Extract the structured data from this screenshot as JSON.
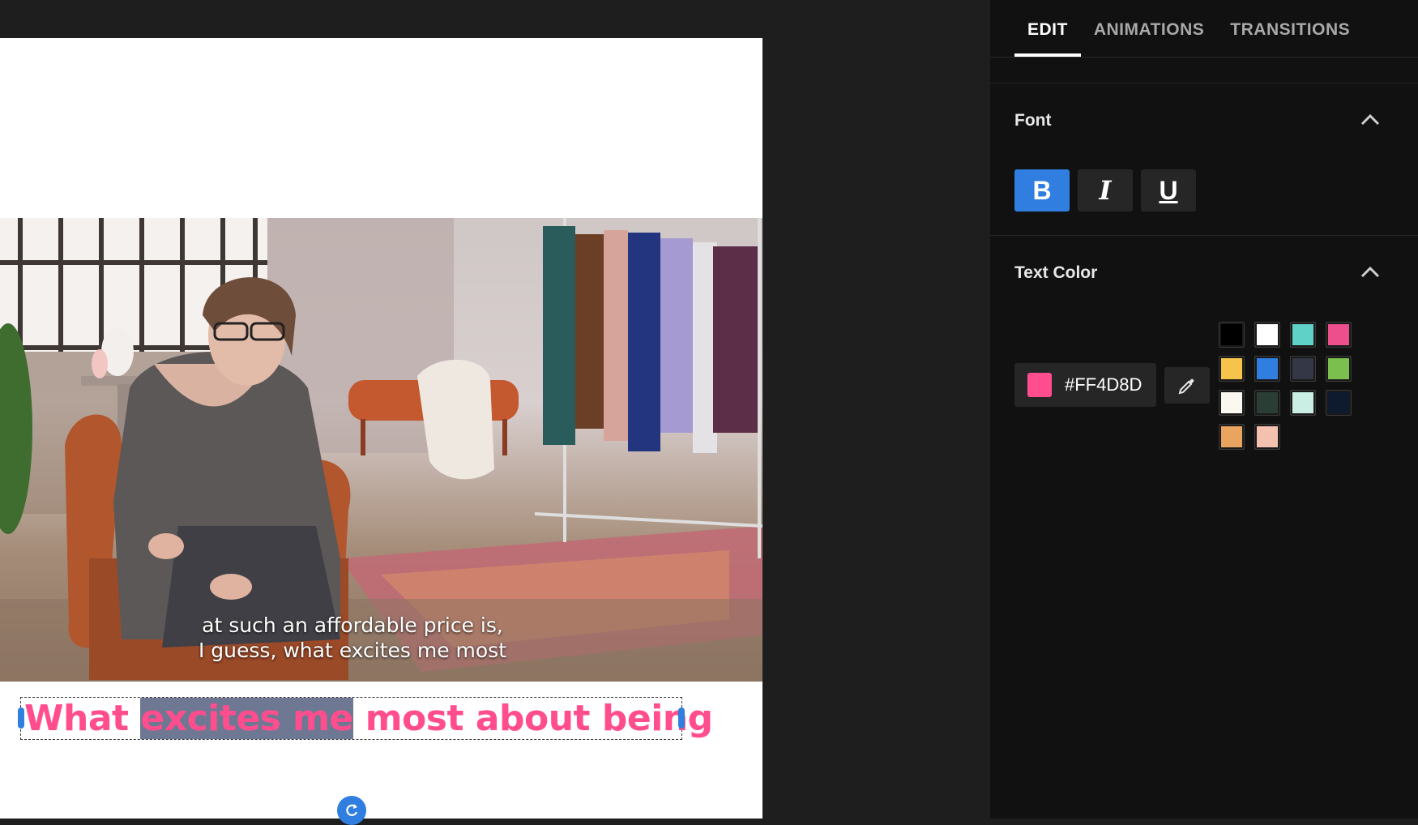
{
  "tabs": [
    "EDIT",
    "ANIMATIONS",
    "TRANSITIONS"
  ],
  "font": {
    "title": "Font",
    "bold": "B",
    "italic": "I",
    "underline": "U"
  },
  "text_color": {
    "title": "Text Color",
    "hex": "#FF4D8D",
    "current": "#ff4d8d",
    "palette": [
      "#000000",
      "#ffffff",
      "#5fd1c6",
      "#ec4f8c",
      "#f7c44b",
      "#2f7ee0",
      "#343745",
      "#7bbf4e",
      "#fbf8f2",
      "#2b3e36",
      "#cbeee4",
      "#0e1a2e",
      "#e9a55f",
      "#f4c1b0"
    ]
  },
  "preview": {
    "subtitle_line1": "at such an affordable price is,",
    "subtitle_line2": "I guess, what excites me most",
    "caption_before": "What ",
    "caption_selected": "excites me",
    "caption_after": " most about being"
  },
  "icons": {
    "rotate": "rotate-icon",
    "chevron": "chevron-up-icon",
    "eyedropper": "eyedropper-icon"
  },
  "colors": {
    "accent": "#2f7ee0",
    "panel": "#111111",
    "caption": "#ff4d8d"
  }
}
